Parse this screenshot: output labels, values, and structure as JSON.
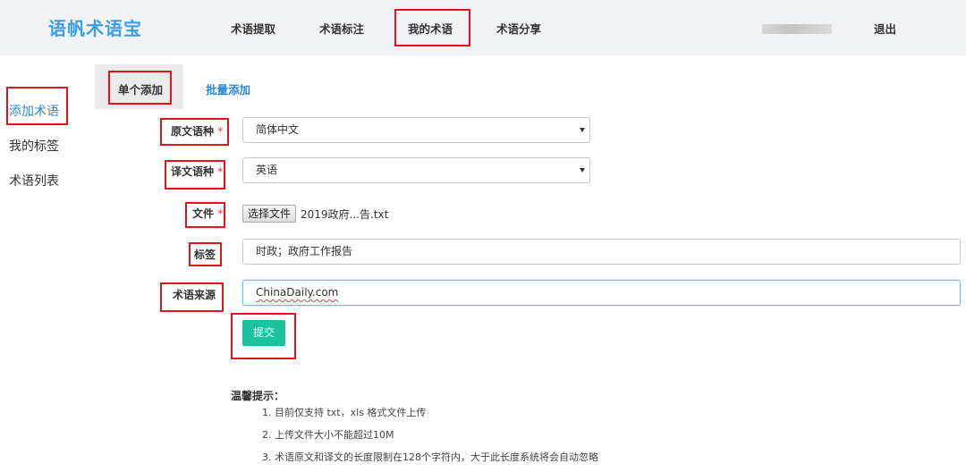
{
  "header": {
    "logo": "语帆术语宝",
    "nav": [
      "术语提取",
      "术语标注",
      "我的术语",
      "术语分享"
    ],
    "logout": "退出"
  },
  "sidebar": {
    "items": [
      "添加术语",
      "我的标签",
      "术语列表"
    ],
    "active_index": 0
  },
  "tabs": [
    "单个添加",
    "批量添加"
  ],
  "form": {
    "source_lang_label": "原文语种",
    "source_lang_value": "简体中文",
    "target_lang_label": "译文语种",
    "target_lang_value": "英语",
    "file_label": "文件",
    "file_button": "选择文件",
    "file_name": "2019政府...告.txt",
    "tags_label": "标签",
    "tags_value": "时政；政府工作报告",
    "source_label": "术语来源",
    "source_value": "ChinaDaily.com",
    "required_mark": "*",
    "submit": "提交"
  },
  "tips": {
    "title": "温馨提示：",
    "items": [
      "1. 目前仅支持 txt，xls 格式文件上传",
      "2. 上传文件大小不能超过10M",
      "3. 术语原文和译文的长度限制在128个字符内，大于此长度系统将会自动忽略"
    ]
  },
  "colors": {
    "brand": "#3aa0e6",
    "active_link": "#2b8ad6",
    "submit": "#19c3a0",
    "highlight": "#e3131b"
  }
}
